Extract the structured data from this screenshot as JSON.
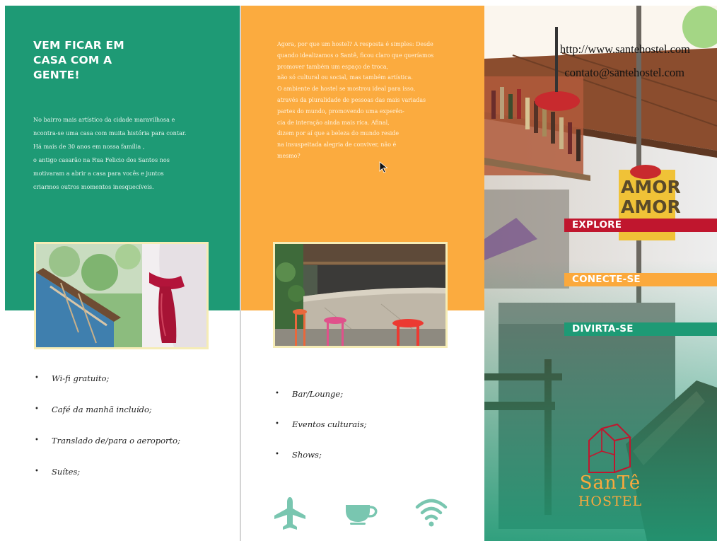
{
  "panel1": {
    "headline": [
      "VEM FICAR EM",
      "CASA COM A",
      "GENTE!"
    ],
    "paragraph": [
      "No bairro mais artístico da cidade maravilhosa e",
      "ncontra-se uma casa com muita história para contar.",
      "Há mais de 30 anos em nossa família ,",
      "o antigo casarão na Rua Felicio dos Santos nos",
      "motivaram a abrir a casa para vocês e juntos",
      "criarmos outros momentos inesquecíveis."
    ],
    "amenities": [
      "Wi-fi gratuito;",
      "Café da manhã incluído;",
      "Translado de/para o aeroporto;",
      "Suítes;"
    ]
  },
  "panel2": {
    "paragraph": [
      "Agora, por que um hostel? A resposta é simples: Desde",
      "quando idealizamos o Santê, ficou claro que queríamos",
      "promover também um espaço de troca,",
      "não só cultural ou social, mas também artística.",
      "O ambiente de hostel se mostrou ideal para isso,",
      "através da pluralidade de pessoas das mais variadas",
      "partes do mundo,  promovendo uma experên-",
      "cia de interação ainda mais rica. Afinal,",
      "dizem por aí que a beleza do mundo reside",
      "na insuspeitada alegria de conviver, não é",
      "mesmo?"
    ],
    "amenities": [
      "Bar/Lounge;",
      "Eventos culturais;",
      "Shows;"
    ],
    "icons": [
      "airplane-icon",
      "coffee-cup-icon",
      "wifi-icon"
    ]
  },
  "panel3": {
    "url": "http://www.santehostel.com",
    "email": "contato@santehostel.com",
    "menu": [
      "EXPLORE",
      "CONECTE-SE",
      "DIVIRTA-SE"
    ],
    "sign_text": [
      "AMOR",
      "AMOR"
    ],
    "logo_line1": "SanTê",
    "logo_line2": "HOSTEL"
  },
  "colors": {
    "green": "#1e9a75",
    "orange": "#fbab3f",
    "red": "#c0162e",
    "icon_teal": "#79c6b0"
  }
}
